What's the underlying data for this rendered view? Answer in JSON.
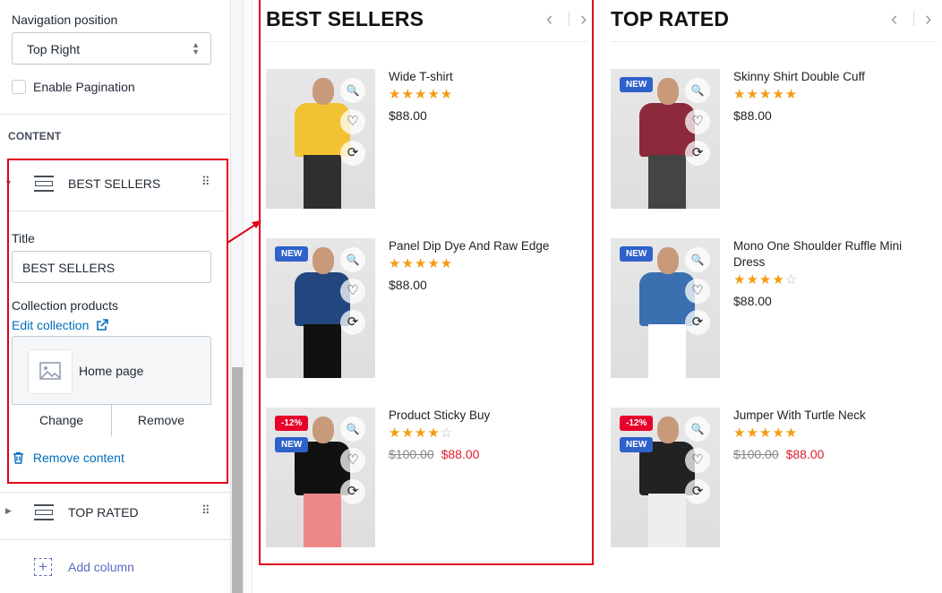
{
  "sidebar": {
    "nav_position_label": "Navigation position",
    "nav_position_value": "Top Right",
    "enable_pagination_label": "Enable Pagination",
    "content_heading": "CONTENT",
    "blocks": [
      {
        "label": "BEST SELLERS",
        "expanded": true
      },
      {
        "label": "TOP RATED",
        "expanded": false
      }
    ],
    "title_label": "Title",
    "title_value": "BEST SELLERS",
    "collection_label": "Collection products",
    "edit_collection_link": "Edit collection",
    "collection_name": "Home page",
    "change_button": "Change",
    "remove_button": "Remove",
    "remove_content_link": "Remove content",
    "add_column_label": "Add column"
  },
  "preview": {
    "columns": [
      {
        "title": "BEST SELLERS",
        "products": [
          {
            "name": "Wide T-shirt",
            "rating": 5,
            "price": "$88.00",
            "old_price": "",
            "badges": []
          },
          {
            "name": "Panel Dip Dye And Raw Edge",
            "rating": 5,
            "price": "$88.00",
            "old_price": "",
            "badges": [
              "NEW"
            ]
          },
          {
            "name": "Product Sticky Buy",
            "rating": 4,
            "price": "$88.00",
            "old_price": "$100.00",
            "badges": [
              "-12%",
              "NEW"
            ]
          }
        ]
      },
      {
        "title": "TOP RATED",
        "products": [
          {
            "name": "Skinny Shirt Double Cuff",
            "rating": 5,
            "price": "$88.00",
            "old_price": "",
            "badges": [
              "NEW"
            ]
          },
          {
            "name": "Mono One Shoulder Ruffle Mini Dress",
            "rating": 4,
            "price": "$88.00",
            "old_price": "",
            "badges": [
              "NEW"
            ]
          },
          {
            "name": "Jumper With Turtle Neck",
            "rating": 5,
            "price": "$88.00",
            "old_price": "$100.00",
            "badges": [
              "-12%",
              "NEW"
            ]
          }
        ]
      }
    ]
  },
  "colors": {
    "highlight": "#e0001b",
    "star": "#f39c12",
    "badge_new": "#2f61ca",
    "badge_sale": "#e7002a",
    "sale_price": "#e11d2a",
    "link": "#006fbb"
  }
}
